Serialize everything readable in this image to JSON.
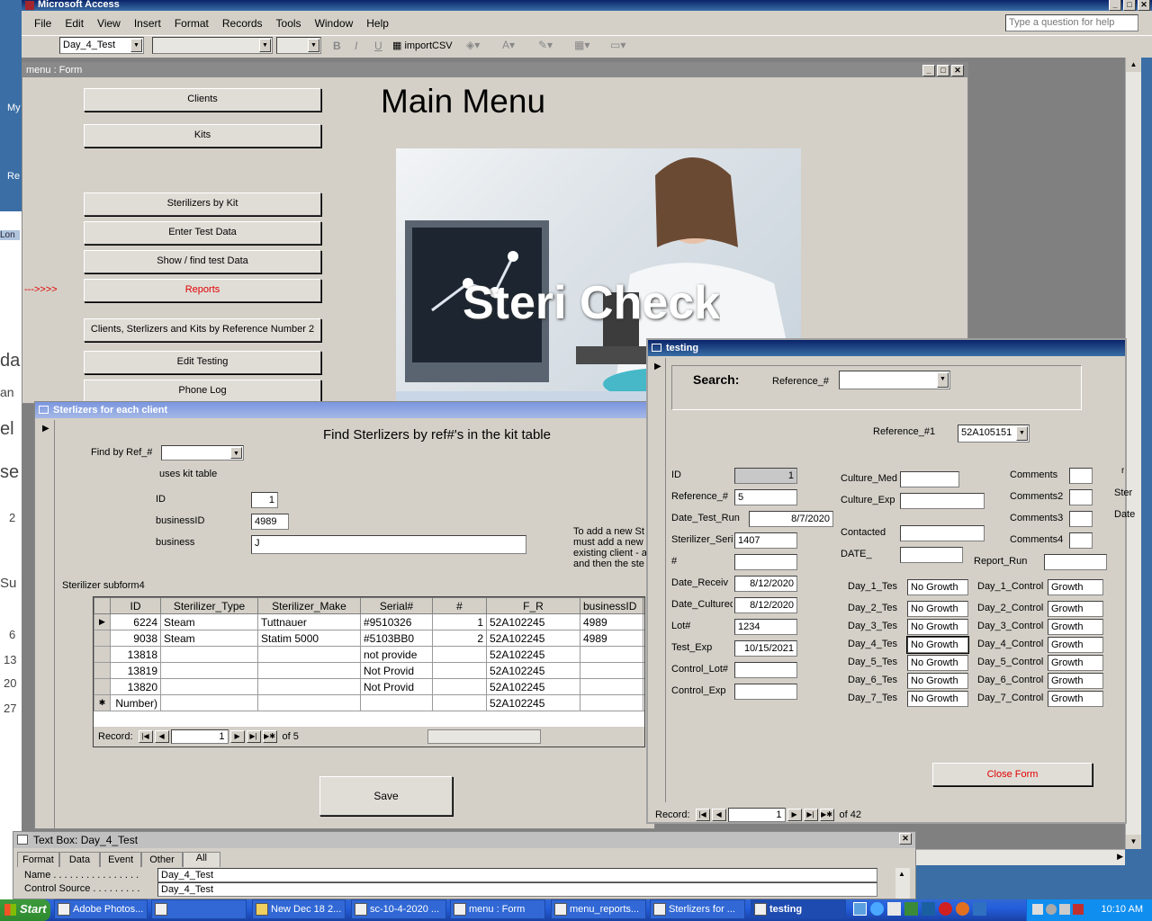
{
  "app": {
    "title": "Microsoft Access",
    "help_placeholder": "Type a question for help"
  },
  "menubar": [
    "File",
    "Edit",
    "View",
    "Insert",
    "Format",
    "Records",
    "Tools",
    "Window",
    "Help"
  ],
  "toolbar": {
    "object_combo": "Day_4_Test",
    "import_label": "importCSV"
  },
  "menu_form": {
    "title": "menu : Form",
    "heading": "Main Menu",
    "banner_text": "Steri Check",
    "arrow": "--->>>>",
    "buttons": [
      "Clients",
      "Kits",
      "Sterilizers by Kit",
      "Enter Test Data",
      "Show / find test Data",
      "Reports",
      "Clients, Sterlizers and Kits by Reference Number 2",
      "Edit Testing",
      "Phone Log"
    ],
    "colors": {
      "reports": "#e00000",
      "accent": "#0a246a"
    }
  },
  "desktop_left": [
    "My",
    "Re",
    "Lon",
    "da",
    "an",
    "el",
    "se",
    "2",
    "Su",
    "6",
    "13",
    "20",
    "27"
  ],
  "sterilizers": {
    "title": "Sterlizers for each client",
    "heading": "Find Sterlizers by ref#'s in the kit table",
    "find_label": "Find by Ref_#",
    "uses_label": "uses kit table",
    "id_label": "ID",
    "id_value": "1",
    "bizid_label": "businessID",
    "bizid_value": "4989",
    "biz_label": "business",
    "biz_value": "J",
    "note": "To add a new St must add a new existing client - a and then the ste",
    "subform_label": "Sterilizer subform4",
    "columns": [
      "ID",
      "Sterilizer_Type",
      "Sterilizer_Make",
      "Serial#",
      "#",
      "F_R",
      "businessID"
    ],
    "rows": [
      [
        "6224",
        "Steam",
        "Tuttnauer",
        "#9510326",
        "1",
        "52A102245",
        "4989"
      ],
      [
        "9038",
        "Steam",
        "Statim 5000",
        "#5103BB0",
        "2",
        "52A102245",
        "4989"
      ],
      [
        "13818",
        "",
        "",
        "not provide",
        "",
        "52A102245",
        ""
      ],
      [
        "13819",
        "",
        "",
        "Not Provid",
        "",
        "52A102245",
        ""
      ],
      [
        "13820",
        "",
        "",
        "Not Provid",
        "",
        "52A102245",
        ""
      ],
      [
        "Number)",
        "",
        "",
        "",
        "",
        "52A102245",
        ""
      ]
    ],
    "record_label": "Record:",
    "record_num": "1",
    "record_of": "of  5",
    "save": "Save"
  },
  "testing": {
    "title": "testing",
    "search": "Search:",
    "ref_label": "Reference_#",
    "ref1_label": "Reference_#1",
    "ref1_value": "52A105151",
    "left_fields": [
      {
        "label": "ID",
        "value": "1"
      },
      {
        "label": "Reference_#",
        "value": "5"
      },
      {
        "label": "Date_Test_Run",
        "value": "8/7/2020"
      },
      {
        "label": "Sterilizer_Seri",
        "value": "1407"
      },
      {
        "label": "#",
        "value": ""
      },
      {
        "label": "Date_Receiv",
        "value": "8/12/2020"
      },
      {
        "label": "Date_Culturec",
        "value": "8/12/2020"
      },
      {
        "label": "Lot#",
        "value": "1234"
      },
      {
        "label": "Test_Exp",
        "value": "10/15/2021"
      },
      {
        "label": "Control_Lot#",
        "value": ""
      },
      {
        "label": "Control_Exp",
        "value": ""
      }
    ],
    "mid_fields": [
      {
        "label": "Culture_Med",
        "value": ""
      },
      {
        "label": "Culture_Exp",
        "value": ""
      },
      {
        "label": "Contacted",
        "value": ""
      },
      {
        "label": "DATE_",
        "value": ""
      }
    ],
    "comments": [
      "Comments",
      "Comments2",
      "Comments3",
      "Comments4"
    ],
    "report_run": "Report_Run",
    "right_edge": [
      "r",
      "Ster",
      "Date"
    ],
    "days": [
      {
        "t": "Day_1_Tes",
        "tv": "No Growth",
        "c": "Day_1_Control",
        "cv": "Growth"
      },
      {
        "t": "Day_2_Tes",
        "tv": "No Growth",
        "c": "Day_2_Control",
        "cv": "Growth"
      },
      {
        "t": "Day_3_Tes",
        "tv": "No Growth",
        "c": "Day_3_Control",
        "cv": "Growth"
      },
      {
        "t": "Day_4_Tes",
        "tv": "No Growth",
        "c": "Day_4_Control",
        "cv": "Growth"
      },
      {
        "t": "Day_5_Tes",
        "tv": "No Growth",
        "c": "Day_5_Control",
        "cv": "Growth"
      },
      {
        "t": "Day_6_Tes",
        "tv": "No Growth",
        "c": "Day_6_Control",
        "cv": "Growth"
      },
      {
        "t": "Day_7_Tes",
        "tv": "No Growth",
        "c": "Day_7_Control",
        "cv": "Growth"
      }
    ],
    "close": "Close Form",
    "record_label": "Record:",
    "record_num": "1",
    "record_of": "of  42"
  },
  "props": {
    "title": "Text Box: Day_4_Test",
    "tabs": [
      "Format",
      "Data",
      "Event",
      "Other",
      "All"
    ],
    "rows": [
      {
        "k": "Name . . . . . . . . . . . . . . . .",
        "v": "Day_4_Test"
      },
      {
        "k": "Control Source . . . . . . . . .",
        "v": "Day_4_Test"
      }
    ]
  },
  "taskbar": {
    "start": "Start",
    "items": [
      "Adobe Photos...",
      "",
      "New Dec 18 2...",
      "sc-10-4-2020 ...",
      "menu : Form",
      "menu_reports...",
      "Sterlizers for ...",
      "testing"
    ],
    "clock": "10:10 AM"
  }
}
